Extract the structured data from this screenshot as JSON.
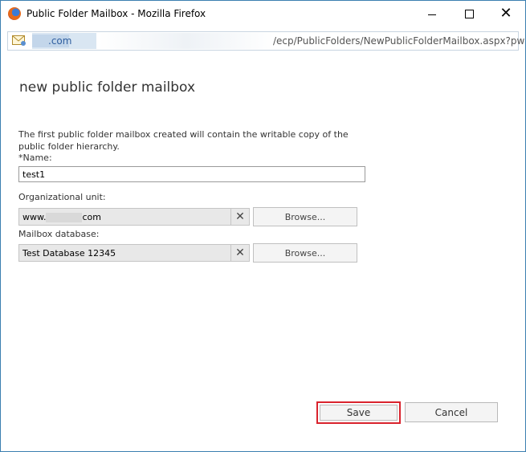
{
  "window": {
    "title": "Public Folder Mailbox - Mozilla Firefox"
  },
  "address_bar": {
    "domain_suffix": ".com",
    "path": "/ecp/PublicFolders/NewPublicFolderMailbox.aspx?pw"
  },
  "form": {
    "heading": "new public folder mailbox",
    "description": "The first public folder mailbox created will contain the writable copy of the public folder hierarchy.",
    "name": {
      "label": "*Name:",
      "value": "test1"
    },
    "organizational_unit": {
      "label": "Organizational unit:",
      "value_prefix": "www.",
      "value_suffix": "com",
      "browse_label": "Browse..."
    },
    "mailbox_database": {
      "label": "Mailbox database:",
      "value": "Test Database 12345",
      "browse_label": "Browse..."
    }
  },
  "footer": {
    "save_label": "Save",
    "cancel_label": "Cancel"
  },
  "colors": {
    "window_border": "#3c7fb1",
    "save_highlight": "#d9232d"
  },
  "icons": {
    "browser": "firefox-icon",
    "site": "mail-icon",
    "clear": "clear-x-icon"
  }
}
